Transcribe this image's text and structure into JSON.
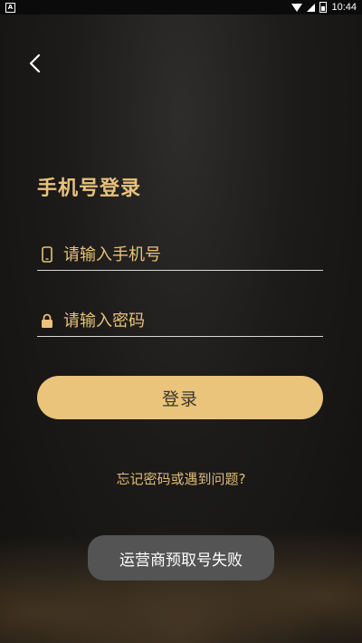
{
  "status_bar": {
    "time": "10:44",
    "app_icon_letter": "A"
  },
  "colors": {
    "accent": "#eac47b",
    "background": "#1c1b19",
    "toast": "#545454"
  },
  "header": {
    "back_icon": "chevron-left-icon"
  },
  "login": {
    "title": "手机号登录",
    "phone_placeholder": "请输入手机号",
    "phone_value": "",
    "password_placeholder": "请输入密码",
    "password_value": "",
    "submit_label": "登录",
    "forgot_link": "忘记密码或遇到问题?"
  },
  "toast": {
    "message": "运营商预取号失败"
  }
}
